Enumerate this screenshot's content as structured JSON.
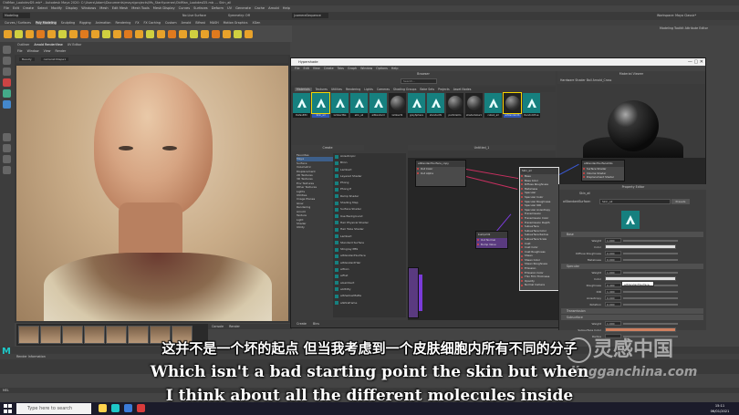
{
  "window": {
    "title": "OldMan_LookdevD5.mb* - Autodesk Maya 2020: C:\\Users\\Adam\\Documents\\maya\\projects\\Ms_Start\\scenes\\OldMan_LookdevD5.mb  ---  Skin_ail",
    "workspace_label": "Workspace: Maya Classic*"
  },
  "menubar": [
    "File",
    "Edit",
    "Create",
    "Select",
    "Modify",
    "Display",
    "Windows",
    "Mesh",
    "Edit Mesh",
    "Mesh Tools",
    "Mesh Display",
    "Curves",
    "Surfaces",
    "Deform",
    "UV",
    "Generate",
    "Cache",
    "Arnold",
    "Help"
  ],
  "statusline": {
    "mode": "Modeling",
    "no_live": "No Live Surface",
    "symmetry": "Symmetry: Off",
    "camera": "|cameraSequence"
  },
  "shelf_tabs": [
    "Curves / Surfaces",
    "Poly Modeling",
    "Sculpting",
    "Rigging",
    "Animation",
    "Rendering",
    "FX",
    "FX Caching",
    "Custom",
    "Arnold",
    "Bifrost",
    "MASH",
    "Motion Graphics",
    "XGen"
  ],
  "right_tabs": [
    "Modeling Toolkit",
    "Attribute Editor",
    "Channel Box"
  ],
  "viewport": {
    "tabs": [
      "Outliner",
      "Arnold RenderView",
      "UV Editor"
    ],
    "menu": [
      "File",
      "Window",
      "View",
      "Render"
    ],
    "camera_field": "Beauty",
    "camera_name": "camera1Shape1"
  },
  "console_tabs": [
    "Console",
    "Render"
  ],
  "hypershade": {
    "title": "Hypershade",
    "menu": [
      "File",
      "Edit",
      "View",
      "Create",
      "Tabs",
      "Graph",
      "Window",
      "Options",
      "Help"
    ],
    "browser_title": "Browser",
    "search_placeholder": "Search...",
    "browser_tabs": [
      "Materials",
      "Textures",
      "Utilities",
      "Rendering",
      "Lights",
      "Cameras",
      "Shading Groups",
      "Bake Sets",
      "Projects",
      "Asset Nodes"
    ],
    "materials": [
      {
        "label": "DefaultPri",
        "kind": "arnold",
        "selected": false
      },
      {
        "label": "Skin_ail",
        "kind": "arnold",
        "selected": true
      },
      {
        "label": "lambertSG",
        "kind": "arnold",
        "selected": false
      },
      {
        "label": "skin_ail",
        "kind": "arnold",
        "selected": false
      },
      {
        "label": "aiStandard",
        "kind": "arnold",
        "selected": false
      },
      {
        "label": "lambert1",
        "kind": "sphere",
        "selected": false
      },
      {
        "label": "greySphere",
        "kind": "arnold",
        "selected": false
      },
      {
        "label": "standardS",
        "kind": "arnold",
        "selected": false
      },
      {
        "label": "particleClo",
        "kind": "sphere",
        "selected": false
      },
      {
        "label": "shaderGlow1",
        "kind": "sphere",
        "selected": false
      },
      {
        "label": "cube1_ail",
        "kind": "arnold",
        "selected": false
      },
      {
        "label": "aiStandardS",
        "kind": "sphere",
        "selected": true
      },
      {
        "label": "RandomHue",
        "kind": "arnold",
        "selected": false
      }
    ],
    "preview_title": "Material Viewer",
    "preview_bar": "Hardware    Shader Ball    Arnold_Cross",
    "create_title": "Create",
    "create_categories": [
      "Favorites",
      "Maya",
      "Surface",
      "Volumetric",
      "Displacement",
      "2D Textures",
      "3D Textures",
      "Env Textures",
      "Other Textures",
      "Lights",
      "Utilities",
      "Image Planes",
      "Glow",
      "Rendering",
      "Arnold",
      "Texture",
      "Light",
      "Shader",
      "Utility"
    ],
    "shaders": [
      "Anisotropic",
      "Blinn",
      "Lambert",
      "Layered Shader",
      "Phong",
      "Phong E",
      "Ramp Shader",
      "Shading Map",
      "Surface Shader",
      "Use Background",
      "Hair Physical Shader",
      "Hair Tube Shader",
      "Lambert",
      "Standard Surface",
      "Stingray PBS",
      "aiStandardSurface",
      "aiStandardHair",
      "aiToon",
      "aiFlat",
      "aiLambert",
      "aiUtility",
      "aiShadowMatte",
      "aiWireframe"
    ],
    "node_editor_title": "Untitled_1",
    "nodes": {
      "file": {
        "title": "aiStandardSurface_copy",
        "ports": [
          "Out Color",
          "Out Alpha"
        ]
      },
      "main": {
        "title": "Skin_ail",
        "ports": [
          "Base",
          "Base Color",
          "Diffuse Roughness",
          "Metalness",
          "Specular",
          "Specular Color",
          "Specular Roughness",
          "Specular IOR",
          "Specular Anisotropy",
          "Transmission",
          "Transmission Color",
          "Transmission Depth",
          "Subsurface",
          "Subsurface Color",
          "Subsurface Radius",
          "Subsurface Scale",
          "Coat",
          "Coat Color",
          "Coat Roughness",
          "Sheen",
          "Sheen Color",
          "Sheen Roughness",
          "Emission",
          "Emission Color",
          "Thin Film Thickness",
          "Opacity",
          "Normal Camera"
        ]
      },
      "sg": {
        "title": "aiStandardSurface1SG",
        "ports": [
          "Surface Shader",
          "Volume Shader",
          "Displacement Shader"
        ]
      },
      "bump": {
        "title": "bump2d1",
        "ports": [
          "Out Normal",
          "Bump Value"
        ]
      }
    },
    "bottom_tabs": [
      "Create",
      "Bins"
    ]
  },
  "attribute_editor": {
    "title": "Property Editor",
    "tab": "Skin_ail",
    "name_label": "aiStandardSurface:",
    "name_value": "Skin_ail",
    "preset_label": "Presets",
    "sections": [
      {
        "label": "Base",
        "rows": [
          {
            "label": "Weight",
            "value": "1.000"
          },
          {
            "label": "Color",
            "value": ""
          },
          {
            "label": "Diffuse Roughness",
            "value": "0.000"
          },
          {
            "label": "Metalness",
            "value": "0.000"
          }
        ]
      },
      {
        "label": "Specular",
        "rows": [
          {
            "label": "Weight",
            "value": "1.000"
          },
          {
            "label": "Color",
            "value": ""
          },
          {
            "label": "Roughness",
            "value": "0.400"
          },
          {
            "label": "IOR",
            "value": "1.400"
          },
          {
            "label": "Anisotropy",
            "value": "0.000"
          },
          {
            "label": "Rotation",
            "value": "0.000"
          }
        ]
      },
      {
        "label": "Transmission",
        "rows": []
      },
      {
        "label": "Subsurface",
        "rows": [
          {
            "label": "Weight",
            "value": "1.000"
          },
          {
            "label": "Subsurface Color",
            "value": ""
          },
          {
            "label": "Radius",
            "value": ""
          }
        ]
      }
    ],
    "tooltip": "aiStandardSurface"
  },
  "helpline": "Render Information",
  "cmd_label": "MEL",
  "subtitles": {
    "cn": "这并不是一个坏的起点 但当我考虑到一个皮肤细胞内所有不同的分子",
    "en_line1": "Which isn't a bad starting point the skin but when",
    "en_line2": "I think about all the different molecules inside"
  },
  "watermark": {
    "cn": "灵感中国",
    "url": "lingganchina.com"
  },
  "taskbar": {
    "search_placeholder": "Type here to search",
    "time": "15:11",
    "date": "06/01/2021"
  },
  "colors": {
    "arnold_teal": "#16807f",
    "selection_yellow": "#f5d400",
    "wire_red": "#c83060",
    "wire_blue": "#3b5bd9",
    "maya_teal": "#1ec7c7"
  }
}
